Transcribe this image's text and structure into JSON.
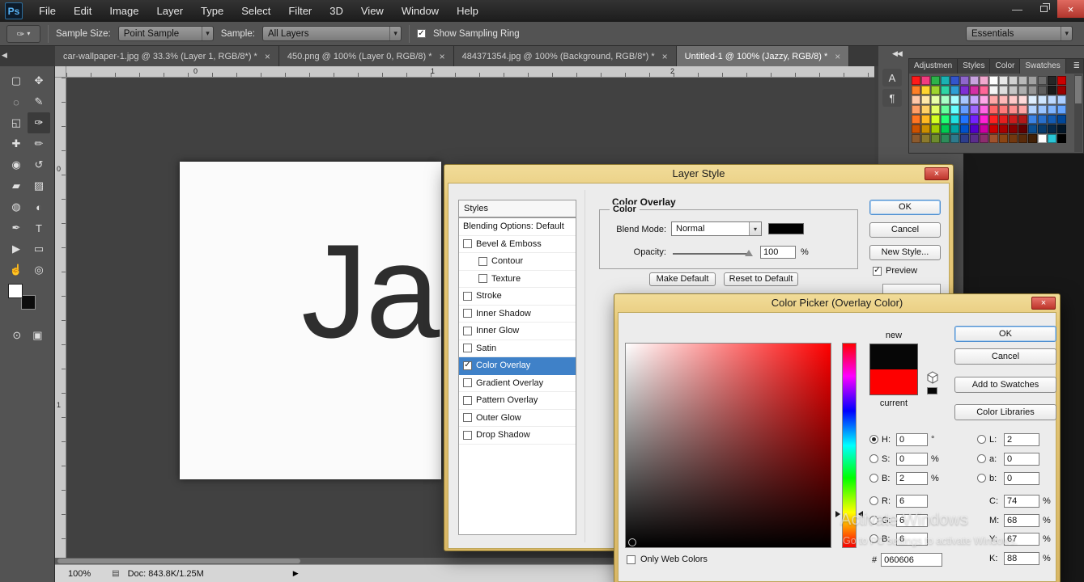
{
  "icons": {
    "ps_logo": "Ps",
    "eyedropper": "✑",
    "dropdown_arrow": "▾",
    "checkmark": "✓",
    "close": "×",
    "minimize": "—",
    "collapse_double_arrow": "◀◀",
    "scroll_tabs_arrow": "◀",
    "panel_menu": "≣",
    "status_arrow": "▶",
    "doc_icon": "▤",
    "quick_mask": "⊙",
    "screen_mode": "▣"
  },
  "menu_bar": {
    "items": [
      "File",
      "Edit",
      "Image",
      "Layer",
      "Type",
      "Select",
      "Filter",
      "3D",
      "View",
      "Window",
      "Help"
    ]
  },
  "options_bar": {
    "sample_size_label": "Sample Size:",
    "sample_size_value": "Point Sample",
    "sample_label": "Sample:",
    "sample_value": "All Layers",
    "show_sampling_ring_label": "Show Sampling Ring",
    "workspace_value": "Essentials"
  },
  "document_tabs": [
    {
      "title": "car-wallpaper-1.jpg @ 33.3% (Layer 1, RGB/8*) *",
      "active": false
    },
    {
      "title": "450.png @ 100% (Layer 0, RGB/8) *",
      "active": false
    },
    {
      "title": "484371354.jpg @ 100% (Background, RGB/8*) *",
      "active": false
    },
    {
      "title": "Untitled-1 @ 100% (Jazzy, RGB/8) *",
      "active": true
    }
  ],
  "tools": [
    {
      "name": "rectangular-marquee-tool",
      "glyph": "▢",
      "selected": false
    },
    {
      "name": "move-tool",
      "glyph": "✥",
      "selected": false
    },
    {
      "name": "lasso-tool",
      "glyph": "◌",
      "selected": false
    },
    {
      "name": "quick-selection-tool",
      "glyph": "✎",
      "selected": false
    },
    {
      "name": "crop-tool",
      "glyph": "◱",
      "selected": false
    },
    {
      "name": "eyedropper-tool",
      "glyph": "✑",
      "selected": true
    },
    {
      "name": "spot-healing-brush-tool",
      "glyph": "✚",
      "selected": false
    },
    {
      "name": "brush-tool",
      "glyph": "✏",
      "selected": false
    },
    {
      "name": "clone-stamp-tool",
      "glyph": "◉",
      "selected": false
    },
    {
      "name": "history-brush-tool",
      "glyph": "↺",
      "selected": false
    },
    {
      "name": "eraser-tool",
      "glyph": "▰",
      "selected": false
    },
    {
      "name": "gradient-tool",
      "glyph": "▨",
      "selected": false
    },
    {
      "name": "blur-tool",
      "glyph": "◍",
      "selected": false
    },
    {
      "name": "dodge-tool",
      "glyph": "◐",
      "selected": false
    },
    {
      "name": "pen-tool",
      "glyph": "✒",
      "selected": false
    },
    {
      "name": "type-tool",
      "glyph": "T",
      "selected": false
    },
    {
      "name": "path-selection-tool",
      "glyph": "▶",
      "selected": false
    },
    {
      "name": "rectangle-tool",
      "glyph": "▭",
      "selected": false
    },
    {
      "name": "hand-tool",
      "glyph": "☝",
      "selected": false
    },
    {
      "name": "zoom-tool",
      "glyph": "◎",
      "selected": false
    }
  ],
  "tool_colors": {
    "foreground": "#ffffff",
    "background": "#0c0c0c"
  },
  "rulers": {
    "top_labels": [
      "0",
      "1",
      "2"
    ],
    "left_labels": [
      "0",
      "1"
    ]
  },
  "canvas": {
    "text": "Jazzy"
  },
  "right_dock": {
    "collapsed_icons": [
      {
        "name": "character-panel-icon",
        "glyph": "A"
      },
      {
        "name": "paragraph-panel-icon",
        "glyph": "¶"
      }
    ],
    "panel_tabs": [
      "Adjustmen",
      "Styles",
      "Color",
      "Swatches"
    ],
    "active_panel": "Swatches",
    "swatch_rows": [
      [
        "#ff1a1a",
        "#f23d80",
        "#2db34a",
        "#1ab2b2",
        "#3355cc",
        "#8f66cc",
        "#c9a3e0",
        "#f2a9cf",
        "#ffffff",
        "#e8e8e8",
        "#d1d1d1",
        "#b9b9b9",
        "#a1a1a1",
        "#6f6f6f",
        "#262626",
        "#cc0000"
      ],
      [
        "#ff7f27",
        "#ffd52e",
        "#9fd42e",
        "#2ed4a5",
        "#2e9fd4",
        "#7f2ed4",
        "#d42ea5",
        "#ff6699",
        "#f5f5f5",
        "#dedede",
        "#c6c6c6",
        "#aeaeae",
        "#969696",
        "#5e5e5e",
        "#1a1a1a",
        "#990000"
      ],
      [
        "#ffc7a8",
        "#ffe9a8",
        "#e9ffa8",
        "#a8ffc7",
        "#a8ffff",
        "#a8c7ff",
        "#c7a8ff",
        "#ffa8e9",
        "#ffa8a8",
        "#ffb9b9",
        "#ffcaca",
        "#ffdbdb",
        "#e0f0ff",
        "#cfe6ff",
        "#bdd9ff",
        "#abceff"
      ],
      [
        "#ff9e66",
        "#ffd166",
        "#e3ff66",
        "#66ff9e",
        "#66ffff",
        "#669eff",
        "#9e66ff",
        "#ff66e3",
        "#ff6666",
        "#ff7b7b",
        "#ff9090",
        "#ffa5a5",
        "#b3d4ff",
        "#99c4ff",
        "#80b5ff",
        "#66a5ff"
      ],
      [
        "#ff7522",
        "#ffb922",
        "#d4ff22",
        "#22ff75",
        "#22e0e0",
        "#2275ff",
        "#7522ff",
        "#ff22d4",
        "#ff2222",
        "#e61f1f",
        "#cc1c1c",
        "#b31919",
        "#3d85e6",
        "#2970cc",
        "#145cb3",
        "#004799"
      ],
      [
        "#cc5200",
        "#cc8f00",
        "#a3cc00",
        "#00cc52",
        "#00a3a3",
        "#0052cc",
        "#5200cc",
        "#cc00a3",
        "#cc0000",
        "#a80000",
        "#850000",
        "#610000",
        "#0b4f91",
        "#083c6e",
        "#05294b",
        "#021628"
      ],
      [
        "#8c5a2d",
        "#8c7a2d",
        "#6e8c2d",
        "#2d8c5a",
        "#2d7a8c",
        "#2d3e8c",
        "#5a2d8c",
        "#8c2d6e",
        "#a0522d",
        "#8b4513",
        "#73380f",
        "#5a2b0a",
        "#412006",
        "#ffffff",
        "#29c5d6",
        "#000000"
      ]
    ]
  },
  "layer_style_dialog": {
    "title": "Layer Style",
    "styles_header": "Styles",
    "styles_list": [
      {
        "label": "Blending Options: Default",
        "checkbox": false,
        "checked": false,
        "indent": false,
        "selected": false
      },
      {
        "label": "Bevel & Emboss",
        "checkbox": true,
        "checked": false,
        "indent": false,
        "selected": false
      },
      {
        "label": "Contour",
        "checkbox": true,
        "checked": false,
        "indent": true,
        "selected": false
      },
      {
        "label": "Texture",
        "checkbox": true,
        "checked": false,
        "indent": true,
        "selected": false
      },
      {
        "label": "Stroke",
        "checkbox": true,
        "checked": false,
        "indent": false,
        "selected": false
      },
      {
        "label": "Inner Shadow",
        "checkbox": true,
        "checked": false,
        "indent": false,
        "selected": false
      },
      {
        "label": "Inner Glow",
        "checkbox": true,
        "checked": false,
        "indent": false,
        "selected": false
      },
      {
        "label": "Satin",
        "checkbox": true,
        "checked": false,
        "indent": false,
        "selected": false
      },
      {
        "label": "Color Overlay",
        "checkbox": true,
        "checked": true,
        "indent": false,
        "selected": true
      },
      {
        "label": "Gradient Overlay",
        "checkbox": true,
        "checked": false,
        "indent": false,
        "selected": false
      },
      {
        "label": "Pattern Overlay",
        "checkbox": true,
        "checked": false,
        "indent": false,
        "selected": false
      },
      {
        "label": "Outer Glow",
        "checkbox": true,
        "checked": false,
        "indent": false,
        "selected": false
      },
      {
        "label": "Drop Shadow",
        "checkbox": true,
        "checked": false,
        "indent": false,
        "selected": false
      }
    ],
    "section_title": "Color Overlay",
    "group_label": "Color",
    "blend_mode_label": "Blend Mode:",
    "blend_mode_value": "Normal",
    "blend_color": "#000000",
    "opacity_label": "Opacity:",
    "opacity_value": "100",
    "opacity_unit": "%",
    "make_default": "Make Default",
    "reset_to_default": "Reset to Default",
    "ok": "OK",
    "cancel": "Cancel",
    "new_style": "New Style...",
    "preview_label": "Preview"
  },
  "color_picker_dialog": {
    "title": "Color Picker (Overlay Color)",
    "new_label": "new",
    "current_label": "current",
    "new_color": "#060606",
    "current_color": "#fe0000",
    "ok": "OK",
    "cancel": "Cancel",
    "add_to_swatches": "Add to Swatches",
    "color_libraries": "Color Libraries",
    "fields_left": [
      {
        "name": "hue",
        "radio": true,
        "checked": true,
        "label": "H:",
        "value": "0",
        "unit": "°"
      },
      {
        "name": "saturation",
        "radio": true,
        "checked": false,
        "label": "S:",
        "value": "0",
        "unit": "%"
      },
      {
        "name": "brightness",
        "radio": true,
        "checked": false,
        "label": "B:",
        "value": "2",
        "unit": "%"
      },
      {
        "name": "red",
        "radio": true,
        "checked": false,
        "label": "R:",
        "value": "6",
        "unit": ""
      },
      {
        "name": "green",
        "radio": true,
        "checked": false,
        "label": "G:",
        "value": "6",
        "unit": ""
      },
      {
        "name": "blue",
        "radio": true,
        "checked": false,
        "label": "B:",
        "value": "6",
        "unit": ""
      }
    ],
    "fields_right": [
      {
        "name": "lab-l",
        "radio": true,
        "checked": false,
        "label": "L:",
        "value": "2",
        "unit": ""
      },
      {
        "name": "lab-a",
        "radio": true,
        "checked": false,
        "label": "a:",
        "value": "0",
        "unit": ""
      },
      {
        "name": "lab-b",
        "radio": true,
        "checked": false,
        "label": "b:",
        "value": "0",
        "unit": ""
      },
      {
        "name": "cyan",
        "radio": false,
        "checked": false,
        "label": "C:",
        "value": "74",
        "unit": "%"
      },
      {
        "name": "magenta",
        "radio": false,
        "checked": false,
        "label": "M:",
        "value": "68",
        "unit": "%"
      },
      {
        "name": "yellow",
        "radio": false,
        "checked": false,
        "label": "Y:",
        "value": "67",
        "unit": "%"
      },
      {
        "name": "black",
        "radio": false,
        "checked": false,
        "label": "K:",
        "value": "88",
        "unit": "%"
      }
    ],
    "hex_label": "#",
    "hex_value": "060606",
    "only_web_colors": "Only Web Colors"
  },
  "status_bar": {
    "zoom": "100%",
    "doc_info": "Doc: 843.8K/1.25M"
  },
  "watermark": {
    "line1": "Activate Windows",
    "line2": "Go to PC settings to activate Windows."
  }
}
